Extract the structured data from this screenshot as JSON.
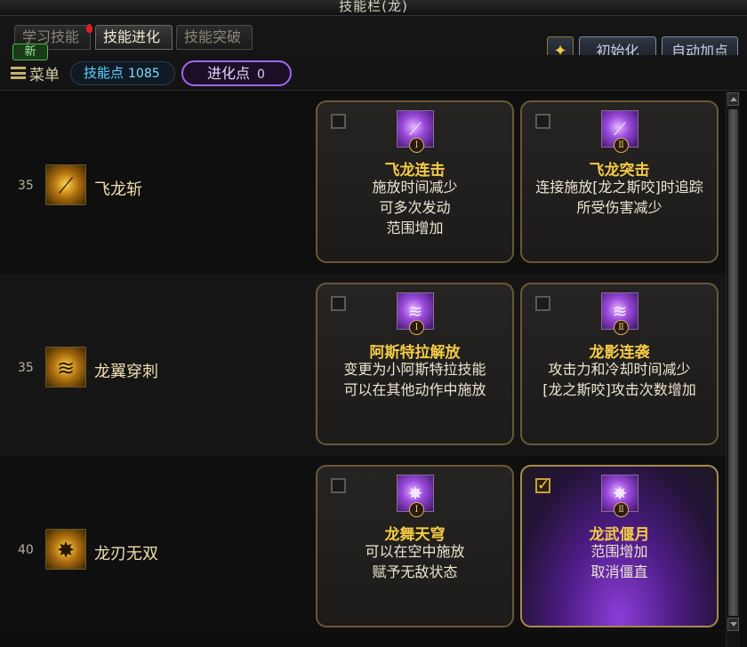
{
  "window": {
    "title": "技能栏(龙)"
  },
  "tabs": [
    {
      "label": "学习技能",
      "active": false,
      "alert": true
    },
    {
      "label": "技能进化",
      "active": true
    },
    {
      "label": "技能突破",
      "active": false
    }
  ],
  "new_badge": "新",
  "toolbar": {
    "star_icon": "star-i-icon",
    "reset_label": "初始化",
    "auto_label": "自动加点"
  },
  "menubar": {
    "menu_label": "菜单",
    "skill_points_label": "技能点",
    "skill_points_value": "1085",
    "evolve_points_label": "进化点",
    "evolve_points_value": "0"
  },
  "rows": [
    {
      "level": "35",
      "skill_name": "飞龙斩",
      "icon": "dragon-claw-slash-icon",
      "cards": [
        {
          "tier": "Ⅰ",
          "checked": false,
          "title": "飞龙连击",
          "desc": [
            "施放时间减少",
            "可多次发动",
            "范围增加"
          ]
        },
        {
          "tier": "Ⅱ",
          "checked": false,
          "title": "飞龙突击",
          "desc": [
            "连接施放[龙之斯咬]时追踪",
            "所受伤害减少"
          ]
        }
      ]
    },
    {
      "level": "35",
      "skill_name": "龙翼穿刺",
      "icon": "dragon-wing-pierce-icon",
      "cards": [
        {
          "tier": "Ⅰ",
          "checked": false,
          "title": "阿斯特拉解放",
          "desc": [
            "变更为小阿斯特拉技能",
            "可以在其他动作中施放"
          ]
        },
        {
          "tier": "Ⅱ",
          "checked": false,
          "title": "龙影连袭",
          "desc": [
            "攻击力和冷却时间减少",
            "[龙之斯咬]攻击次数增加"
          ]
        }
      ]
    },
    {
      "level": "40",
      "skill_name": "龙刃无双",
      "icon": "dragon-blade-icon",
      "cards": [
        {
          "tier": "Ⅰ",
          "checked": false,
          "title": "龙舞天穹",
          "desc": [
            "可以在空中施放",
            "赋予无敌状态"
          ]
        },
        {
          "tier": "Ⅱ",
          "checked": true,
          "title": "龙武偃月",
          "desc": [
            "范围增加",
            "取消僵直"
          ]
        }
      ]
    }
  ],
  "colors": {
    "card_title": "#f4cb45",
    "evolve_border": "#a066f0",
    "skill_points": "#5fd0ff",
    "selected_glow": "#8c3ed8"
  }
}
